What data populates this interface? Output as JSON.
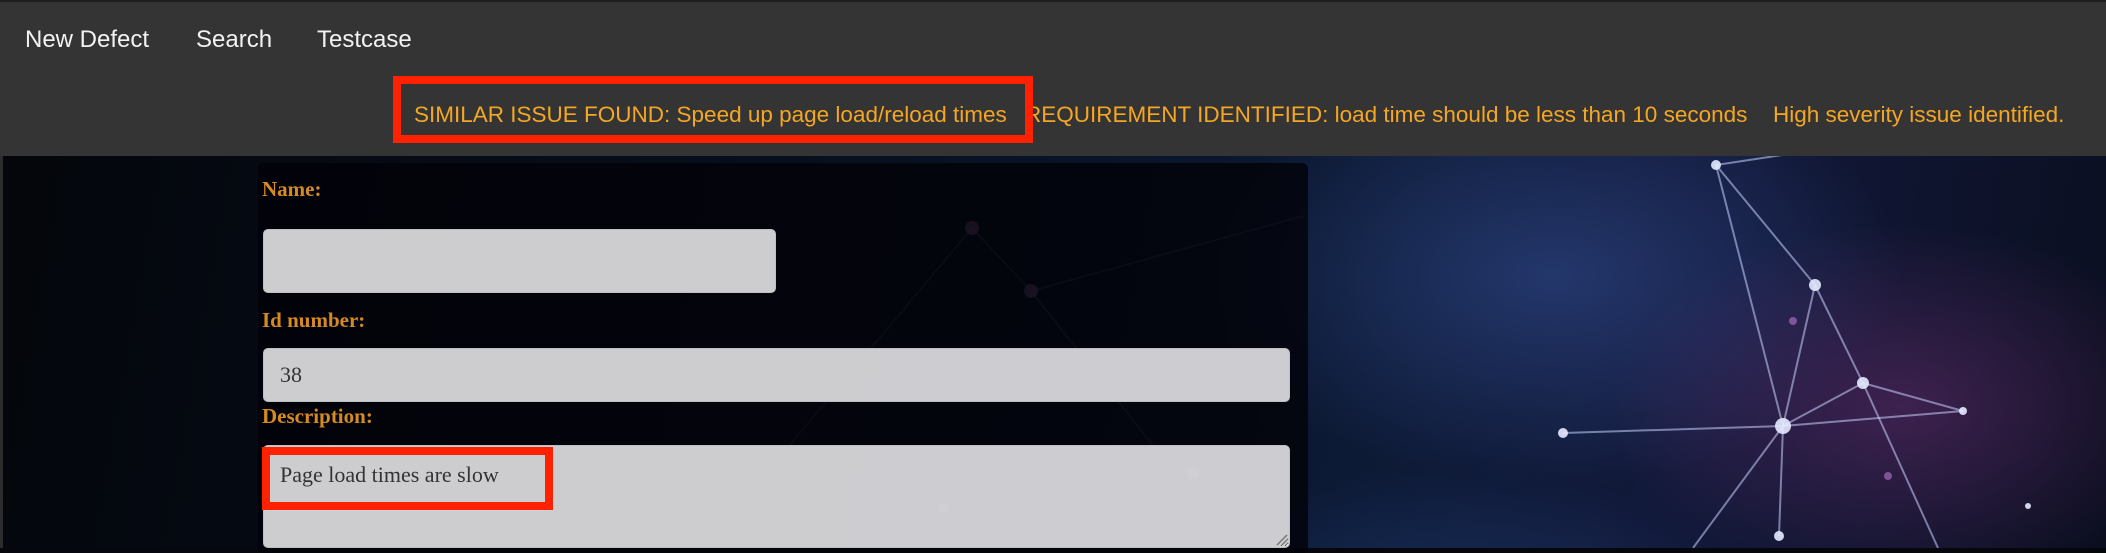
{
  "nav": {
    "new_defect": "New Defect",
    "search": "Search",
    "testcase": "Testcase"
  },
  "alerts": {
    "similar_issue": "SIMILAR ISSUE FOUND: Speed up page load/reload times",
    "requirement": "REQUIREMENT IDENTIFIED: load time should be less than 10 seconds",
    "severity": "High severity issue identified."
  },
  "form": {
    "name_label": "Name:",
    "name_value": "",
    "id_label": "Id number:",
    "id_value": "38",
    "description_label": "Description:",
    "description_value": "Page load times are slow"
  },
  "colors": {
    "navbar_bg": "#343434",
    "nav_text": "#f2f2f2",
    "alert_text": "#f5a623",
    "label_text": "#d68a22",
    "highlight_box": "#ff2200"
  }
}
